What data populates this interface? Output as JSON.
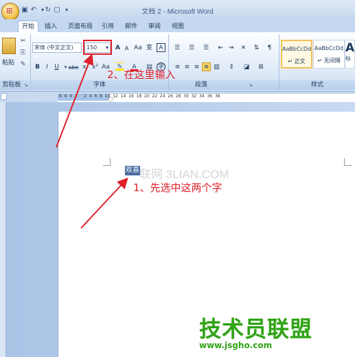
{
  "window": {
    "title": "文档 2 - Microsoft Word"
  },
  "quick_access": [
    "save-icon",
    "undo-icon",
    "redo-icon",
    "new-doc-icon",
    "customize-icon"
  ],
  "tabs": [
    {
      "label": "开始",
      "active": true
    },
    {
      "label": "插入"
    },
    {
      "label": "页面布局"
    },
    {
      "label": "引用"
    },
    {
      "label": "邮件"
    },
    {
      "label": "审阅"
    },
    {
      "label": "视图"
    }
  ],
  "ribbon": {
    "clipboard": {
      "paste_label": "粘贴",
      "group_label": "剪贴板"
    },
    "font": {
      "font_name": "宋体 (中文正文)",
      "font_size": "150",
      "group_label": "字体",
      "buttons": {
        "grow": "A",
        "shrink": "A",
        "clear": "Aa",
        "phonetic": "变",
        "border": "A",
        "bold": "B",
        "italic": "I",
        "underline": "U",
        "strike": "abe",
        "sub": "x₂",
        "sup": "x²",
        "case": "Aa",
        "color": "A",
        "circle": "字"
      }
    },
    "paragraph": {
      "group_label": "段落"
    },
    "styles": {
      "group_label": "样式",
      "items": [
        {
          "preview": "AaBbCcDd",
          "name": "↵ 正文"
        },
        {
          "preview": "AaBbCcDd",
          "name": "↵ 无间隔"
        },
        {
          "preview": "AaBl",
          "name": "标"
        }
      ]
    }
  },
  "ruler": {
    "numbers": "8  6  4  2     2  4  6  8  10  12  14  16  18  20  22  24  26  28  30  32  34  36  38"
  },
  "document": {
    "selected_text": "欢喜"
  },
  "watermark": {
    "text": "联网 3LIAN.COM"
  },
  "annotations": {
    "step1": "1、先选中这两个字",
    "step2": "2、在这里输入",
    "color": "#e0202a"
  },
  "brand": {
    "name": "技术员联盟",
    "url": "www.jsgho.com",
    "color": "#2fa316"
  }
}
